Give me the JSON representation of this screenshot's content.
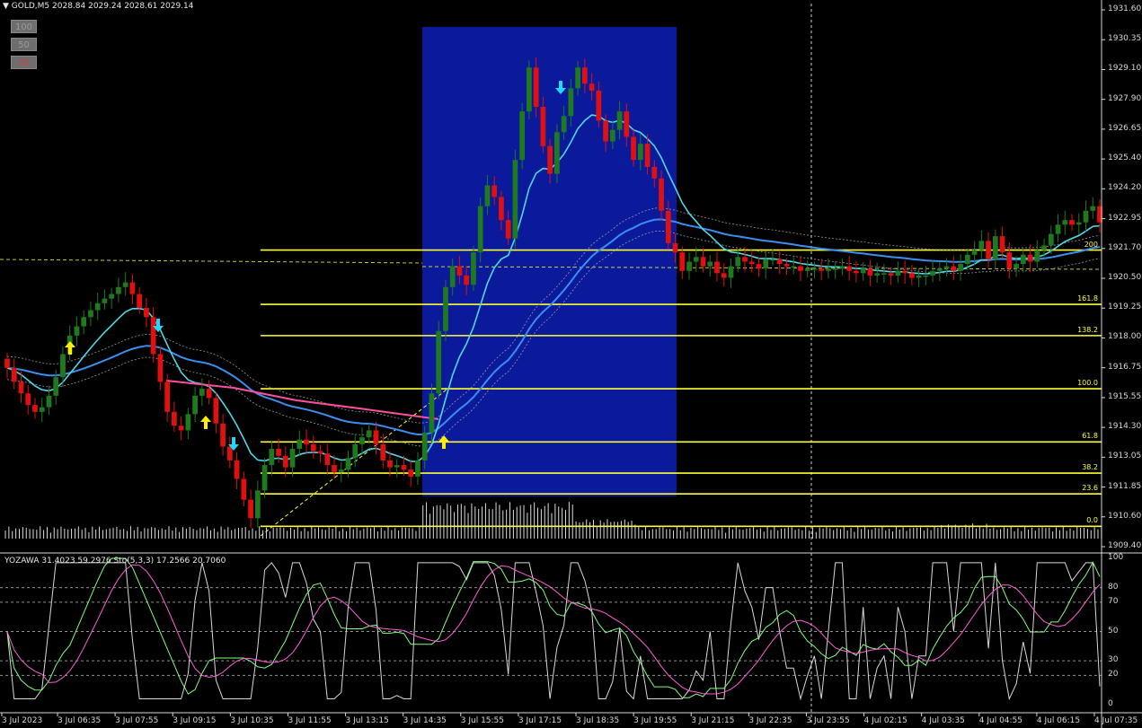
{
  "header": {
    "symbol": "GOLD,M5",
    "quote": "2028.84 2029.24 2028.61 2029.14"
  },
  "zoom_buttons": [
    "100",
    "50",
    "25"
  ],
  "indicator_header": "YOZAWA 31.4023 59.2976 Sto(5,3,3) 17.2566 20.7060",
  "colors": {
    "background": "#000000",
    "bull": "#1f7a1f",
    "bear": "#e01010",
    "fib": "#ffff33",
    "ma_fast": "#4fd8e8",
    "ma_slow": "#3a8ff0",
    "ma_pink": "#ff4fa0",
    "highlight_box": "#0a1a9a",
    "arrow_up": "#ffee00",
    "arrow_down": "#22d8ff"
  },
  "chart_data": {
    "type": "candlestick",
    "price_axis_labels": [
      "1931.60",
      "1930.35",
      "1929.10",
      "1927.90",
      "1926.65",
      "1925.40",
      "1924.20",
      "1922.95",
      "1921.70",
      "1920.50",
      "1919.25",
      "1918.00",
      "1916.75",
      "1915.55",
      "1914.30",
      "1913.05",
      "1911.85",
      "1910.60",
      "1909.40"
    ],
    "osc_axis_labels": [
      "100",
      "80",
      "70",
      "50",
      "30",
      "20",
      "0"
    ],
    "time_labels": [
      "3 Jul 2023",
      "3 Jul 06:35",
      "3 Jul 07:55",
      "3 Jul 09:15",
      "3 Jul 10:35",
      "3 Jul 11:55",
      "3 Jul 13:15",
      "3 Jul 14:35",
      "3 Jul 15:55",
      "3 Jul 17:15",
      "3 Jul 18:35",
      "3 Jul 19:55",
      "3 Jul 21:15",
      "3 Jul 22:35",
      "3 Jul 23:55",
      "4 Jul 02:15",
      "4 Jul 03:35",
      "4 Jul 04:55",
      "4 Jul 06:15",
      "4 Jul 07:35"
    ],
    "price_range": [
      1909.1,
      1931.9
    ],
    "fib_levels": [
      {
        "label": "200",
        "price": 1921.7
      },
      {
        "label": "161.8",
        "price": 1919.35
      },
      {
        "label": "138.2",
        "price": 1918.0
      },
      {
        "label": "100.0",
        "price": 1915.7
      },
      {
        "label": "61.8",
        "price": 1913.4
      },
      {
        "label": "38.2",
        "price": 1912.05
      },
      {
        "label": "23.6",
        "price": 1911.15
      },
      {
        "label": "0.0",
        "price": 1909.75
      }
    ],
    "closes": [
      1916.6,
      1916.0,
      1915.5,
      1915.0,
      1914.7,
      1914.9,
      1915.4,
      1916.2,
      1917.2,
      1918.0,
      1918.4,
      1918.8,
      1919.1,
      1919.4,
      1919.6,
      1919.8,
      1920.1,
      1920.3,
      1919.8,
      1919.2,
      1918.8,
      1917.2,
      1916.0,
      1914.7,
      1914.1,
      1913.9,
      1914.6,
      1915.4,
      1915.7,
      1915.3,
      1914.2,
      1913.2,
      1912.6,
      1911.8,
      1910.9,
      1910.1,
      1911.3,
      1912.4,
      1913.1,
      1912.8,
      1912.3,
      1913.1,
      1913.5,
      1913.3,
      1913.0,
      1912.9,
      1912.4,
      1912.1,
      1912.2,
      1912.7,
      1913.3,
      1913.6,
      1913.9,
      1913.3,
      1912.6,
      1912.3,
      1912.4,
      1912.2,
      1911.9,
      1912.6,
      1913.8,
      1915.5,
      1918.2,
      1920.1,
      1921.0,
      1920.6,
      1920.2,
      1921.6,
      1923.6,
      1924.5,
      1924.0,
      1923.0,
      1922.2,
      1925.6,
      1927.7,
      1929.6,
      1927.9,
      1926.2,
      1925.0,
      1926.8,
      1927.5,
      1928.7,
      1929.6,
      1928.9,
      1928.6,
      1927.3,
      1926.4,
      1926.9,
      1927.7,
      1926.6,
      1925.6,
      1926.3,
      1925.3,
      1924.8,
      1923.4,
      1922.0,
      1921.6,
      1920.8,
      1921.2,
      1921.4,
      1921.0,
      1921.2,
      1920.7,
      1920.5,
      1921.0,
      1921.4,
      1921.2,
      1921.1,
      1920.9,
      1921.3,
      1921.3,
      1921.1,
      1921.0,
      1921.0,
      1920.8,
      1920.9,
      1920.9,
      1920.8,
      1920.9,
      1920.9,
      1921.0,
      1920.8,
      1920.7,
      1920.9,
      1920.6,
      1920.7,
      1920.7,
      1920.6,
      1920.8,
      1920.7,
      1920.5,
      1920.6,
      1920.6,
      1920.8,
      1920.9,
      1921.0,
      1920.8,
      1921.1,
      1921.5,
      1921.7,
      1922.1,
      1921.3,
      1922.3,
      1921.6,
      1920.9,
      1921.1,
      1921.5,
      1921.2,
      1921.7,
      1921.9,
      1922.4,
      1922.8,
      1923.0,
      1922.8,
      1922.9,
      1923.4,
      1923.6,
      1922.9
    ]
  }
}
